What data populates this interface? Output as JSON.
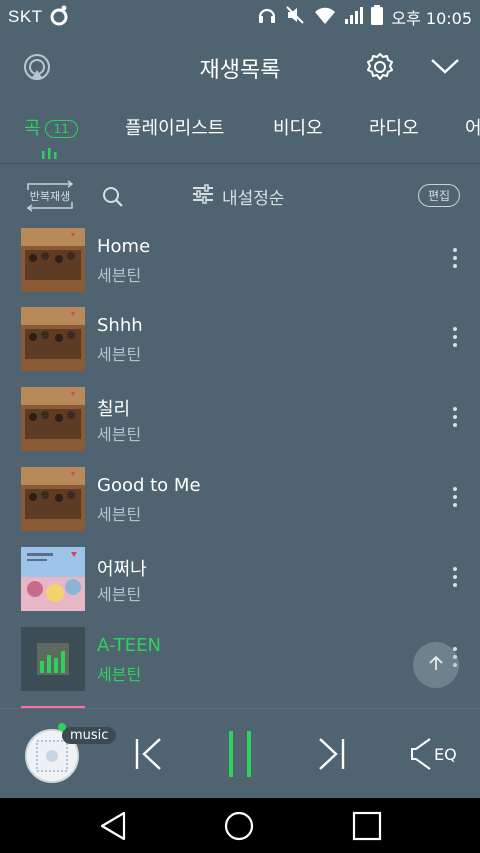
{
  "status_bar": {
    "carrier": "SKT",
    "time": "오후 10:05"
  },
  "header": {
    "title": "재생목록"
  },
  "tabs": [
    {
      "label": "곡",
      "badge": "11",
      "active": true
    },
    {
      "label": "플레이리스트"
    },
    {
      "label": "비디오"
    },
    {
      "label": "라디오"
    },
    {
      "label": "어"
    }
  ],
  "toolbar": {
    "repeat_label": "반복재생",
    "sort_label": "내설정순",
    "edit_label": "편집"
  },
  "songs": [
    {
      "title": "Home",
      "artist": "세븐틴"
    },
    {
      "title": "Shhh",
      "artist": "세븐틴"
    },
    {
      "title": "칠리",
      "artist": "세븐틴"
    },
    {
      "title": "Good to Me",
      "artist": "세븐틴"
    },
    {
      "title": "어쩌나",
      "artist": "세븐틴"
    },
    {
      "title": "A-TEEN",
      "artist": "세븐틴",
      "playing": true
    }
  ],
  "player": {
    "source_tag": "music",
    "eq_label": "EQ"
  },
  "colors": {
    "background": "#4f6470",
    "accent": "#2ed15b",
    "muted_text": "#b7c3ca"
  },
  "icons": {
    "header": [
      "cast-icon",
      "gear-icon",
      "chevron-down-icon"
    ],
    "player": [
      "previous-icon",
      "pause-icon",
      "next-icon",
      "eq-icon"
    ],
    "nav": [
      "back-icon",
      "home-icon",
      "recents-icon"
    ]
  }
}
